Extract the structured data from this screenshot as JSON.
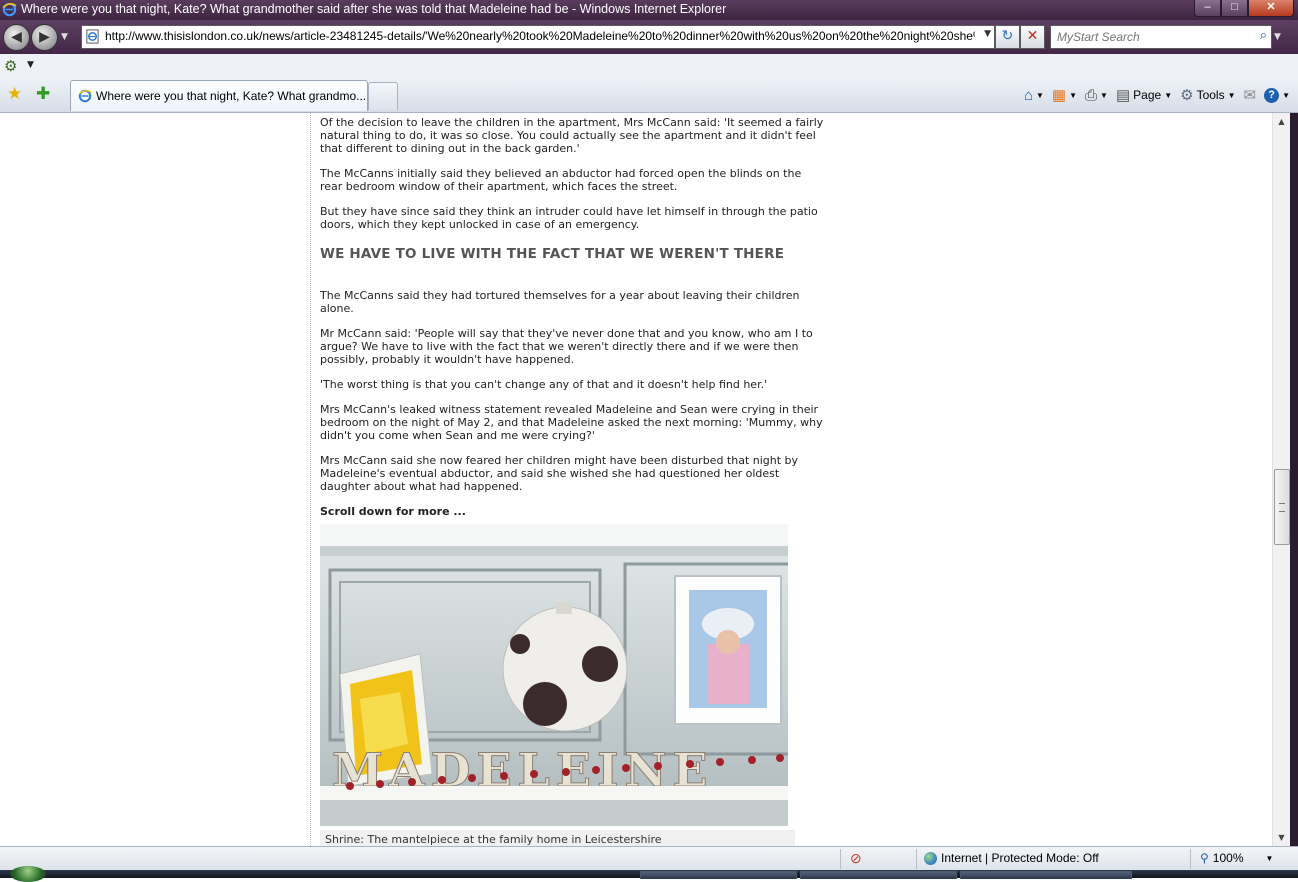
{
  "window": {
    "title": "Where were you that night, Kate? What grandmother said after she was told that Madeleine had be - Windows Internet Explorer",
    "controls": {
      "minimize": "–",
      "maximize": "□",
      "close": "✕"
    }
  },
  "nav": {
    "back_icon": "◀",
    "forward_icon": "▶",
    "url": "http://www.thisislondon.co.uk/news/article-23481245-details/'We%20nearly%20took%20Madeleine%20to%20dinner%20with%20us%20on%20the%20night%20she%",
    "refresh_icon": "↻",
    "stop_icon": "✕",
    "search_placeholder": "MyStart Search",
    "search_icon": "⌕"
  },
  "tab": {
    "label": "Where were you that night, Kate? What grandmo..."
  },
  "toolbar": {
    "home_icon": "⌂",
    "feeds_icon": "▦",
    "print_icon": "⎙",
    "page_label": "Page",
    "tools_label": "Tools",
    "help_icon": "?"
  },
  "article": {
    "paragraphs_top": [
      "Of the decision to leave the children in the apartment, Mrs McCann said: 'It seemed a fairly natural thing to do, it was so close. You could actually see the apartment and it didn't feel that different to dining out in the back garden.'",
      "The McCanns initially said they believed an abductor had forced open the blinds on the rear bedroom window of their apartment, which faces the street.",
      "But they have since said they think an intruder could have let himself in through the patio doors, which they kept unlocked in case of an emergency."
    ],
    "heading": "WE HAVE TO LIVE WITH THE FACT THAT WE WEREN'T THERE",
    "paragraphs_bottom": [
      "The McCanns said they had tortured themselves for a year about leaving their children alone.",
      "Mr McCann said: 'People will say that they've never done that and you know, who am I to argue? We have to live with the fact that we weren't directly there and if we were then possibly, probably it wouldn't have happened.",
      "'The worst thing is that you can't change any of that and it doesn't help find her.'",
      "Mrs McCann's leaked witness statement revealed Madeleine and Sean were crying in their bedroom on the night of May 2, and that Madeleine asked the next morning: 'Mummy, why didn't you come when Sean and me were crying?'",
      "Mrs McCann said she now feared her children might have been disturbed that night by Madeleine's eventual abductor, and said she wished she had questioned her oldest daughter about what had happened."
    ],
    "scroll_note": "Scroll down for more ...",
    "photo_letters": "MADELEINE",
    "caption": "Shrine: The mantelpiece at the family home in Leicestershire"
  },
  "status": {
    "zone": "Internet | Protected Mode: Off",
    "zoom": "100%"
  }
}
